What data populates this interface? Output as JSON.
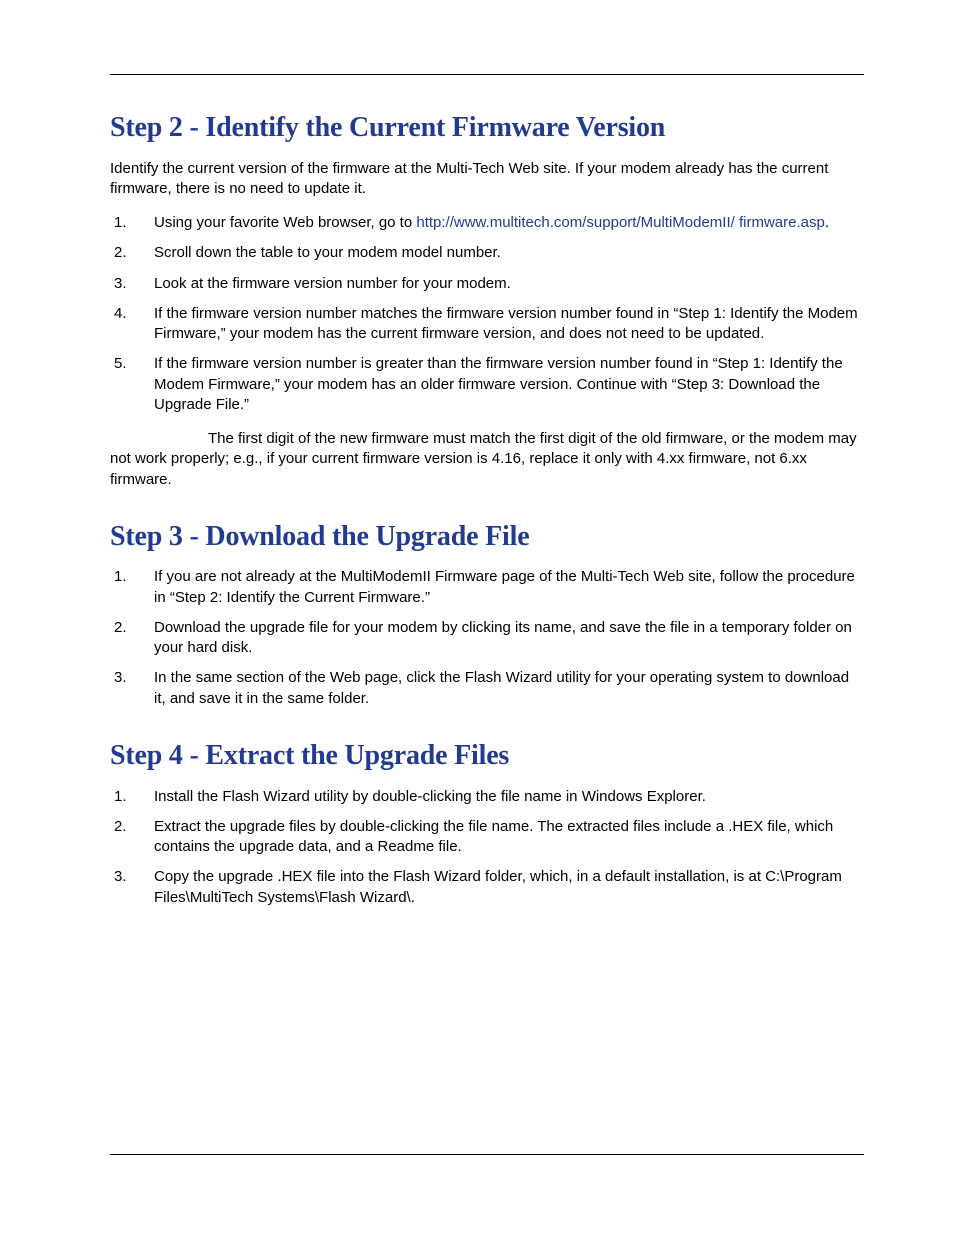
{
  "step2": {
    "heading": "Step 2 - Identify the Current Firmware Version",
    "intro": "Identify the current version of the firmware at the Multi-Tech Web site. If your modem already has the current firmware, there is no need to update it.",
    "items": [
      {
        "pre": "Using your favorite Web browser, go to ",
        "link": "http://www.multitech.com/support/MultiModemII/ firmware.asp",
        "post": "."
      },
      {
        "text": "Scroll down the table to your modem model number."
      },
      {
        "text": "Look at the firmware version number for your modem."
      },
      {
        "text": "If the firmware version number matches the firmware version number found in “Step 1: Identify the Modem Firmware,” your modem has the current firmware version, and does not need to be updated."
      },
      {
        "text": "If the firmware version number is greater than the firmware version number found in “Step 1: Identify the Modem Firmware,” your modem has an older firmware version. Continue with “Step 3: Download the Upgrade File.”"
      }
    ],
    "note": "The first digit of the new firmware must match the first digit of the old firmware, or the modem may not work properly; e.g., if your current firmware version is 4.16, replace it only with 4.xx firmware, not 6.xx firmware."
  },
  "step3": {
    "heading": "Step 3 - Download the Upgrade File",
    "items": [
      {
        "text": "If you are not already at the MultiModemII Firmware page of the Multi-Tech Web site, follow the procedure in “Step 2: Identify the Current Firmware.”"
      },
      {
        "text": "Download the upgrade file for your modem by clicking its name, and save the file in a temporary folder on your hard disk."
      },
      {
        "text": "In the same section of the Web page, click the Flash Wizard utility for your operating system to download it, and save it in the same folder."
      }
    ]
  },
  "step4": {
    "heading": "Step 4 - Extract the Upgrade Files",
    "items": [
      {
        "text": "Install the Flash Wizard utility by double-clicking the file name in Windows Explorer."
      },
      {
        "text": "Extract the upgrade files by double-clicking the file name. The extracted files include a .HEX file, which contains the upgrade data, and a Readme file."
      },
      {
        "text": "Copy the upgrade .HEX file into the Flash Wizard folder, which, in a default installation, is at C:\\Program Files\\MultiTech Systems\\Flash Wizard\\."
      }
    ]
  }
}
